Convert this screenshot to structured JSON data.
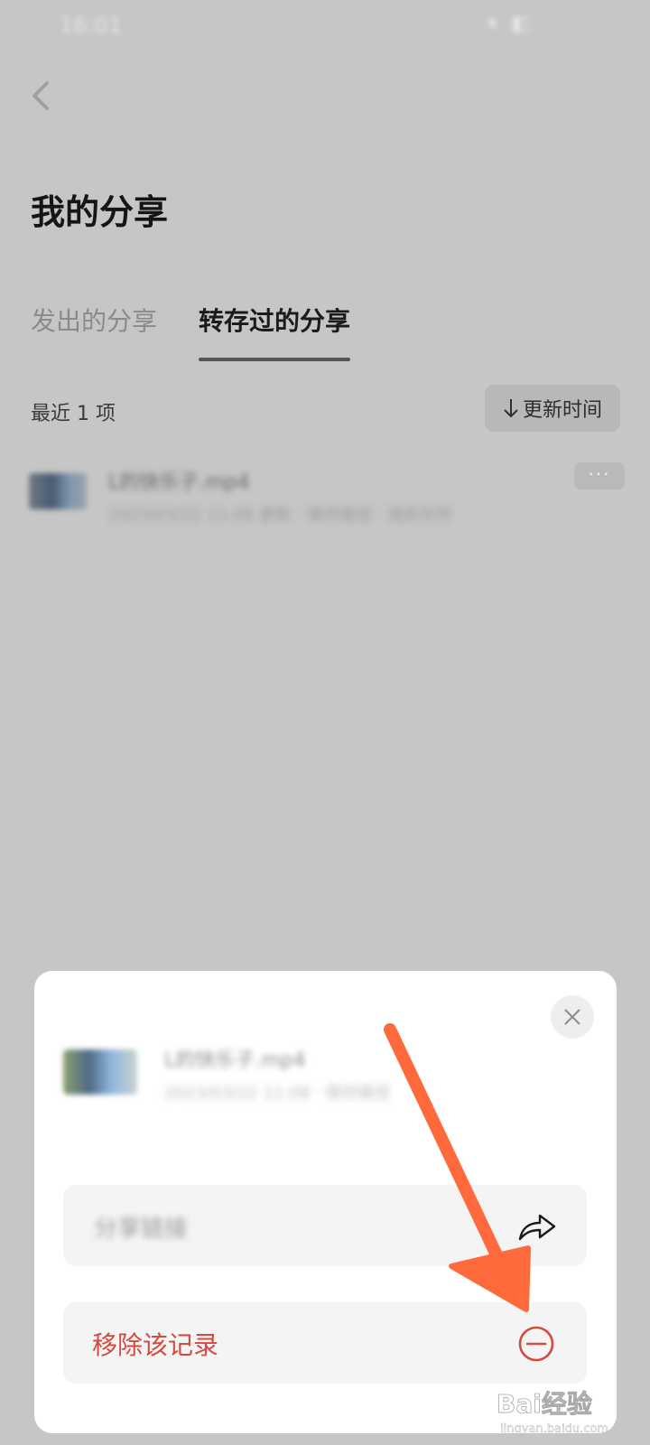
{
  "status_bar": {
    "time": "16:01",
    "icons": "▾ ◧"
  },
  "header": {
    "title": "我的分享"
  },
  "tabs": [
    {
      "label": "发出的分享",
      "active": false
    },
    {
      "label": "转存过的分享",
      "active": true
    }
  ],
  "list": {
    "count_label": "最近 1 项",
    "sort_label": "更新时间",
    "items": [
      {
        "title": "L的快乐子.mp4",
        "meta": "2023/03/22  11:08  更新  ·  保存路径 · 我的文件",
        "more_label": "···"
      }
    ]
  },
  "sheet": {
    "file_title": "L的快乐子.mp4",
    "file_meta": "2023/03/22  11:08  ·  保存路径",
    "actions": [
      {
        "label": "分享链接"
      },
      {
        "label": "移除该记录"
      }
    ]
  },
  "colors": {
    "danger": "#d24b3f",
    "annotation": "#ff6a3d",
    "overlay": "#c6c6c6"
  },
  "watermark": {
    "text": "Bai经验",
    "sub": "jingyan.baidu.com"
  }
}
